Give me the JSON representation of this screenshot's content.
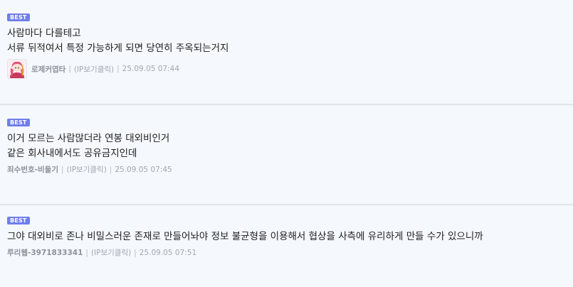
{
  "comments": [
    {
      "badge": "BEST",
      "lines": [
        "사람마다 다를테고",
        "서류 뒤적여서 특정 가능하게 되면 당연히 주옥되는거지"
      ],
      "nickname": "로제커엽타",
      "ip": "(IP보기클릭)",
      "datetime": "25.09.05 07:44",
      "has_avatar": true
    },
    {
      "badge": "BEST",
      "lines": [
        "이거 모르는 사람많더라 연봉 대외비인거",
        "같은 회사내에서도 공유금지인데"
      ],
      "nickname": "죄수번호-비둘기",
      "ip": "(IP보기클릭)",
      "datetime": "25.09.05 07:45",
      "has_avatar": false
    },
    {
      "badge": "BEST",
      "lines": [
        "그야 대외비로 존나 비밀스러운 존재로 만들어놔야 정보 불균형을 이용해서 협상을 사측에 유리하게 만들 수가 있으니까"
      ],
      "nickname": "루리웹-3971833341",
      "ip": "(IP보기클릭)",
      "datetime": "25.09.05 07:51",
      "has_avatar": false
    }
  ],
  "separator": "|",
  "colors": {
    "badge": "#6f7fe8",
    "background": "#f5f8fd",
    "divider": "#dfe3ea",
    "meta_text": "#a3a7ae"
  },
  "icons": {
    "avatar": "user-avatar-icon"
  }
}
